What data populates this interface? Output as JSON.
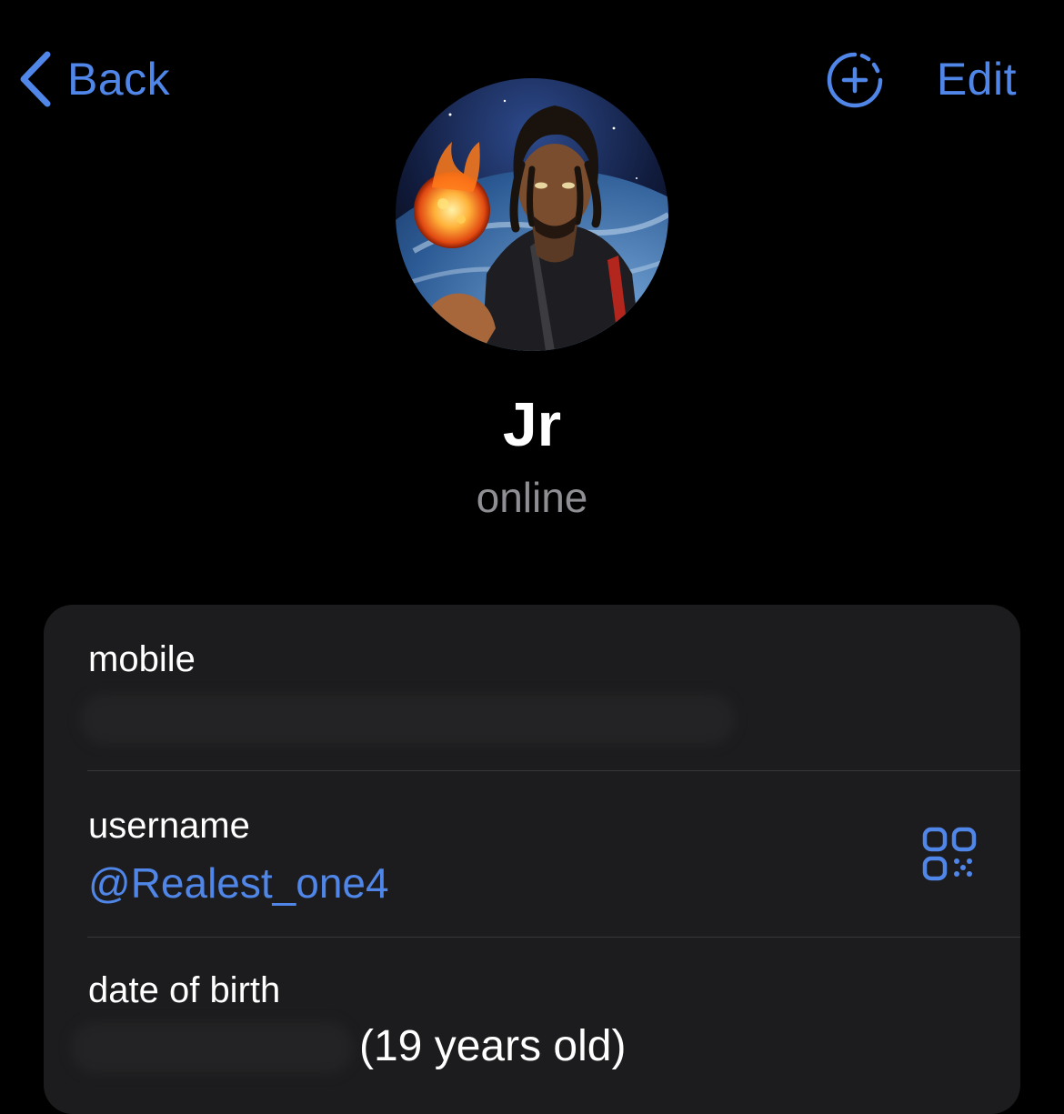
{
  "nav": {
    "back_label": "Back",
    "edit_label": "Edit"
  },
  "profile": {
    "name": "Jr",
    "status": "online"
  },
  "info": {
    "mobile_label": "mobile",
    "mobile_value": "",
    "username_label": "username",
    "username_value": "@Realest_one4",
    "dob_label": "date of birth",
    "dob_age": "(19 years old)"
  },
  "colors": {
    "background": "#000000",
    "card": "#1c1c1e",
    "accent": "#4f86e8",
    "secondary_text": "#8e8e93",
    "divider": "#38383a"
  },
  "icons": {
    "back": "chevron-left-icon",
    "story_add": "add-story-icon",
    "qr": "qr-code-icon"
  }
}
